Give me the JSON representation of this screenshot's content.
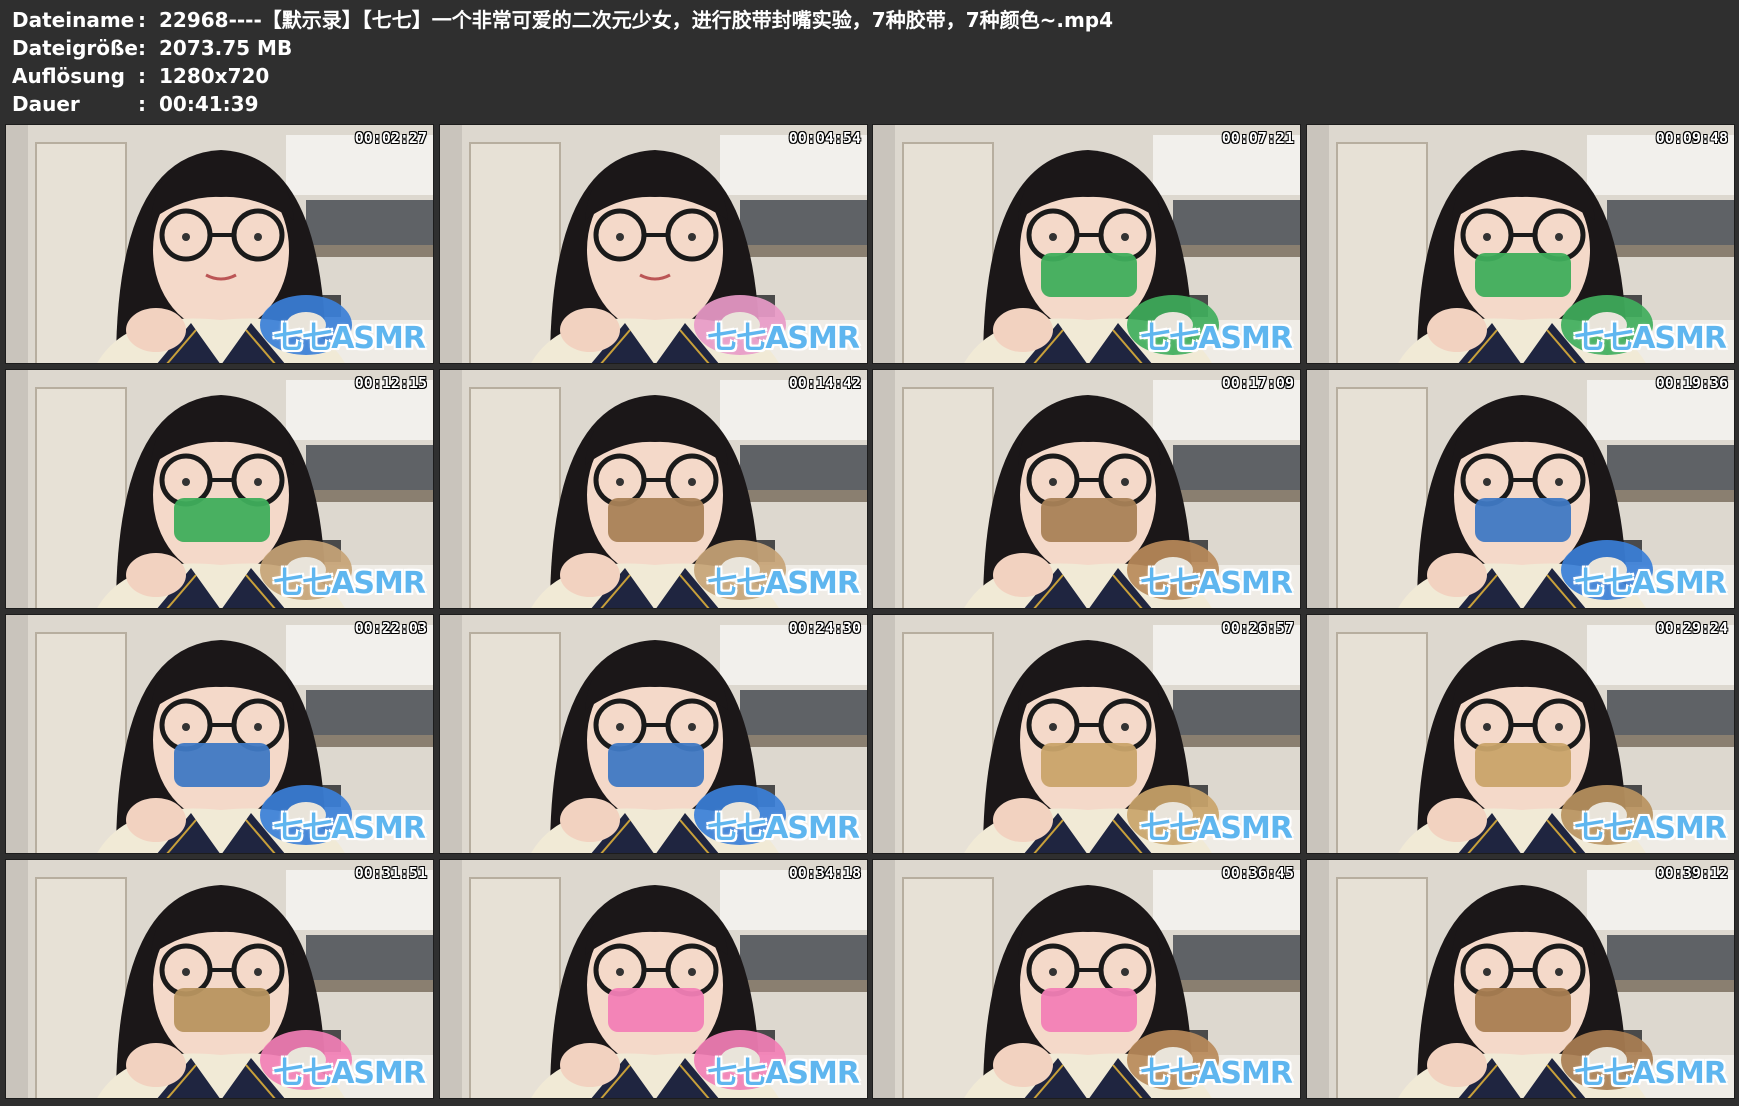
{
  "info": [
    {
      "key": "Dateiname",
      "sep": ":",
      "value": "22968----【默示录】【七七】一个非常可爱的二次元少女，进行胶带封嘴实验，7种胶带，7种颜色~.mp4"
    },
    {
      "key": "Dateigröße",
      "sep": ":",
      "value": "2073.75 MB"
    },
    {
      "key": "Auflösung",
      "sep": ":",
      "value": "1280x720"
    },
    {
      "key": "Dauer",
      "sep": ":",
      "value": "00:41:39"
    }
  ],
  "watermark": "七七ASMR",
  "thumbnails": [
    {
      "timestamp": "00:02:27",
      "tape_color": "#3a7fd8",
      "mouth_tape": "none"
    },
    {
      "timestamp": "00:04:54",
      "tape_color": "#e89ac8",
      "mouth_tape": "none"
    },
    {
      "timestamp": "00:07:21",
      "tape_color": "#3fae5c",
      "mouth_tape": "#3fae5c"
    },
    {
      "timestamp": "00:09:48",
      "tape_color": "#3fae5c",
      "mouth_tape": "#3fae5c"
    },
    {
      "timestamp": "00:12:15",
      "tape_color": "#c7a477",
      "mouth_tape": "#3fae5c"
    },
    {
      "timestamp": "00:14:42",
      "tape_color": "#c7a477",
      "mouth_tape": "#a98257"
    },
    {
      "timestamp": "00:17:09",
      "tape_color": "#b98a5a",
      "mouth_tape": "#a98257"
    },
    {
      "timestamp": "00:19:36",
      "tape_color": "#3a7fd8",
      "mouth_tape": "#3f79c4"
    },
    {
      "timestamp": "00:22:03",
      "tape_color": "#3a7fd8",
      "mouth_tape": "#3f79c4"
    },
    {
      "timestamp": "00:24:30",
      "tape_color": "#3a7fd8",
      "mouth_tape": "#3f79c4"
    },
    {
      "timestamp": "00:26:57",
      "tape_color": "#c9a46a",
      "mouth_tape": "#c9a46a"
    },
    {
      "timestamp": "00:29:24",
      "tape_color": "#b89260",
      "mouth_tape": "#c9a46a"
    },
    {
      "timestamp": "00:31:51",
      "tape_color": "#f27fb6",
      "mouth_tape": "#b89560"
    },
    {
      "timestamp": "00:34:18",
      "tape_color": "#f27fb6",
      "mouth_tape": "#f27fb6"
    },
    {
      "timestamp": "00:36:45",
      "tape_color": "#b98a5a",
      "mouth_tape": "#f27fb6"
    },
    {
      "timestamp": "00:39:12",
      "tape_color": "#a97e52",
      "mouth_tape": "#a97e52"
    }
  ]
}
